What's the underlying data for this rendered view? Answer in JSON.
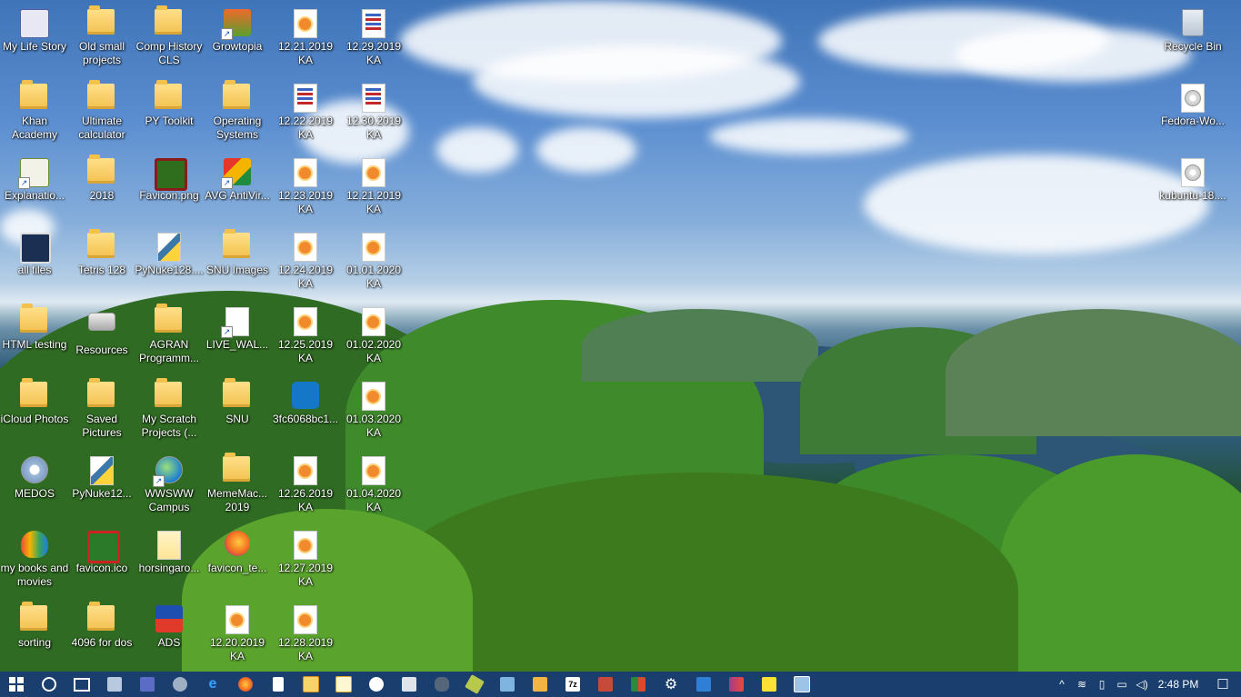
{
  "desktop": {
    "icons": [
      {
        "label": "My Life Story"
      },
      {
        "label": "Old small projects"
      },
      {
        "label": "Comp History CLS"
      },
      {
        "label": "Growtopia"
      },
      {
        "label": "12.21.2019 KA"
      },
      {
        "label": "12.29.2019 KA"
      },
      {
        "label": "Khan Academy"
      },
      {
        "label": "Ultimate calculator"
      },
      {
        "label": "PY Toolkit"
      },
      {
        "label": "Operating Systems"
      },
      {
        "label": "12.22.2019 KA"
      },
      {
        "label": "12.30.2019 KA"
      },
      {
        "label": "Explanatio..."
      },
      {
        "label": "2018"
      },
      {
        "label": "Favicon.png"
      },
      {
        "label": "AVG AntiVir..."
      },
      {
        "label": "12.23.2019 KA"
      },
      {
        "label": "12.21.2019 KA"
      },
      {
        "label": "all files"
      },
      {
        "label": "Tetris 128"
      },
      {
        "label": "PyNuke128...."
      },
      {
        "label": "SNU Images"
      },
      {
        "label": "12.24.2019 KA"
      },
      {
        "label": "01.01.2020 KA"
      },
      {
        "label": "HTML testing"
      },
      {
        "label": "Resources"
      },
      {
        "label": "AGRAN Programm..."
      },
      {
        "label": "LIVE_WAL..."
      },
      {
        "label": "12.25.2019 KA"
      },
      {
        "label": "01.02.2020 KA"
      },
      {
        "label": "iCloud Photos"
      },
      {
        "label": "Saved Pictures"
      },
      {
        "label": "My Scratch Projects (..."
      },
      {
        "label": "SNU"
      },
      {
        "label": "3fc6068bc1..."
      },
      {
        "label": "01.03.2020 KA"
      },
      {
        "label": "MEDOS"
      },
      {
        "label": "PyNuke12..."
      },
      {
        "label": "WWSWW Campus"
      },
      {
        "label": "MemeMac... 2019"
      },
      {
        "label": "12.26.2019 KA"
      },
      {
        "label": "01.04.2020 KA"
      },
      {
        "label": "my books and movies"
      },
      {
        "label": "favicon.ico"
      },
      {
        "label": "horsingaro..."
      },
      {
        "label": "favicon_te..."
      },
      {
        "label": "12.27.2019 KA"
      },
      {
        "label": "sorting"
      },
      {
        "label": "4096 for dos"
      },
      {
        "label": "ADS"
      },
      {
        "label": "12.20.2019 KA"
      },
      {
        "label": "12.28.2019 KA"
      }
    ],
    "right_icons": [
      {
        "label": "Recycle Bin"
      },
      {
        "label": "Fedora-Wo..."
      },
      {
        "label": "kubuntu-18...."
      }
    ]
  },
  "taskbar": {
    "clock": "2:48 PM",
    "accent": "#1a3e6e"
  }
}
